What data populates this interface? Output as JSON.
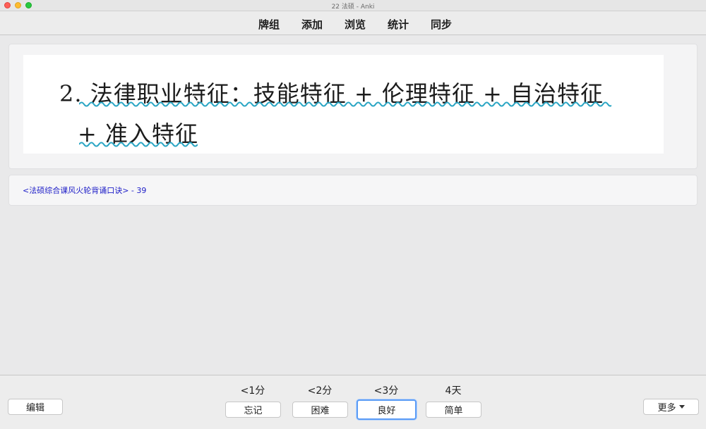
{
  "window": {
    "title": "22 法硕 - Anki"
  },
  "toolbar": {
    "links": [
      "牌组",
      "添加",
      "浏览",
      "统计",
      "同步"
    ]
  },
  "card": {
    "line1": "2. 法律职业特征：技能特征 + 伦理特征 + 自治特征",
    "line2": "+ 准入特征",
    "accent_color": "#2ba6c4"
  },
  "source": {
    "text": "<法硕综合课风火轮背诵口诀> - 39",
    "color": "#2020c8"
  },
  "bottom": {
    "edit_label": "编辑",
    "more_label": "更多",
    "answers": [
      {
        "interval": "<1分",
        "label": "忘记"
      },
      {
        "interval": "<2分",
        "label": "困难"
      },
      {
        "interval": "<3分",
        "label": "良好"
      },
      {
        "interval": "4天",
        "label": "简单"
      }
    ]
  }
}
